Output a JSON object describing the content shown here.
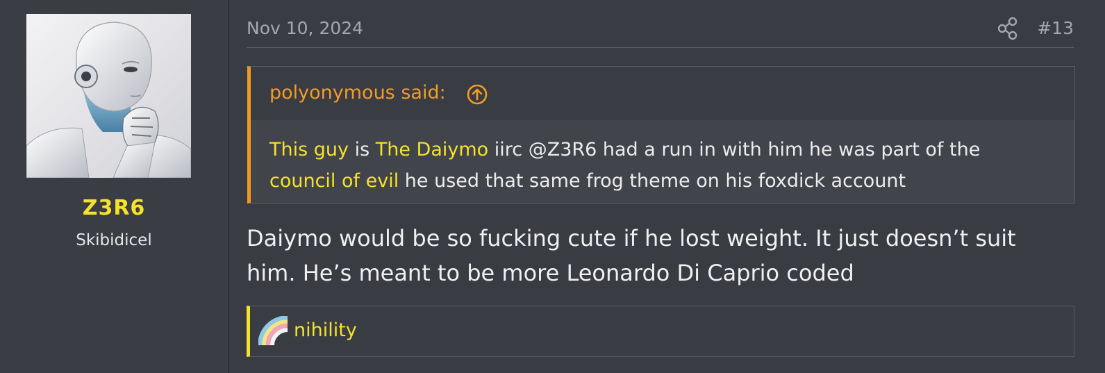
{
  "user": {
    "username": "Z3R6",
    "title": "Skibidicel",
    "avatar_icon": "robot-avatar"
  },
  "post": {
    "date": "Nov 10, 2024",
    "number": "#13",
    "share_icon": "share-icon"
  },
  "quote": {
    "author": "polyonymous said:",
    "jump_icon": "arrow-up-circle-icon",
    "body": {
      "link1": "This guy",
      "text1": " is ",
      "link2": "The Daiymo",
      "text2": " iirc @Z3R6 had a run in with him he was part of the",
      "link3": "council of evil",
      "text3": " he used that same frog theme on his foxdick account"
    }
  },
  "message": {
    "line1": "Daiymo would be so fucking cute if he lost weight. It just doesn’t suit",
    "line2": "him. He’s meant to be more Leonardo Di Caprio coded"
  },
  "reactions": {
    "icon": "rainbow-reaction-icon",
    "users": "nihility"
  },
  "colors": {
    "accent_yellow": "#f5e22b",
    "quote_orange": "#ef9a1f",
    "background": "#393c43"
  }
}
